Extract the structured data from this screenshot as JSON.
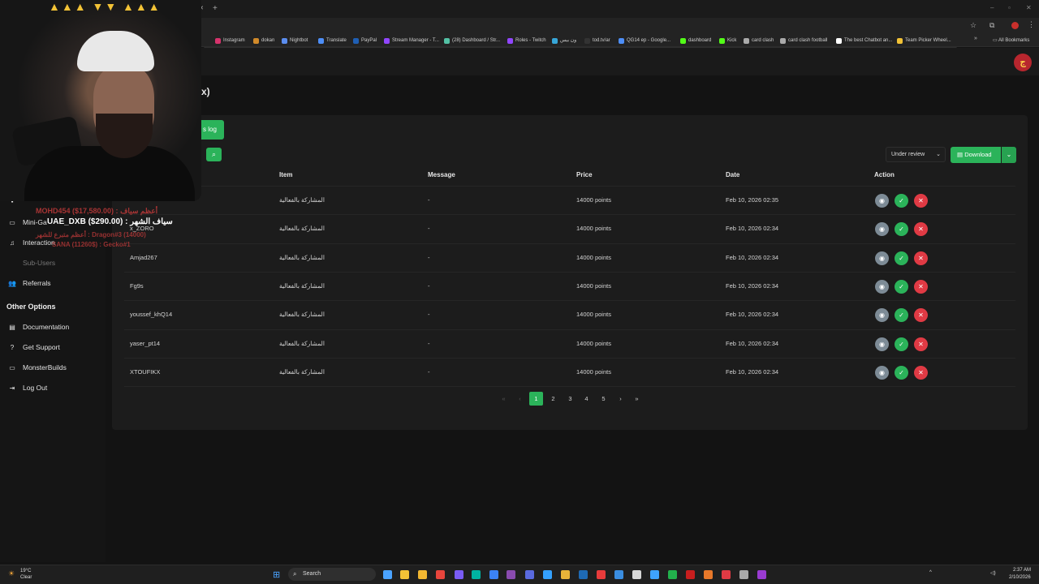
{
  "bookmarks": [
    {
      "label": "Instagram",
      "color": "#d6336c"
    },
    {
      "label": "dokan",
      "color": "#d18a2a"
    },
    {
      "label": "Nightbot",
      "color": "#5b8def"
    },
    {
      "label": "Translate",
      "color": "#4d8ef7"
    },
    {
      "label": "PayPal",
      "color": "#1f5fb4"
    },
    {
      "label": "Stream Manager - T...",
      "color": "#9146ff"
    },
    {
      "label": "(28) Dashboard / Str...",
      "color": "#53c1a5"
    },
    {
      "label": "Roles - Twitch",
      "color": "#9146ff"
    },
    {
      "label": "ون بيس",
      "color": "#37a6d8"
    },
    {
      "label": "tod.tv/ar",
      "color": "#333333"
    },
    {
      "label": "QG14 ep - Google...",
      "color": "#4d8ef7"
    },
    {
      "label": "dashboard",
      "color": "#53fc18"
    },
    {
      "label": "Kick",
      "color": "#53fc18"
    },
    {
      "label": "card clash",
      "color": "#aaaaaa"
    },
    {
      "label": "card clash football",
      "color": "#aaaaaa"
    },
    {
      "label": "The best Chatbot an...",
      "color": "#ffffff"
    },
    {
      "label": "Team Picker Wheel...",
      "color": "#f2c236"
    }
  ],
  "bookmarks_bar": {
    "all_bookmarks": "All Bookmarks"
  },
  "page": {
    "title_fragment": "x)"
  },
  "tabs": {
    "log_label": "s log"
  },
  "sidebar": {
    "items": [
      {
        "label": "Mini-Ga",
        "icon": "gamepad-icon",
        "glyph": "▭"
      },
      {
        "label": "Interaction",
        "icon": "music-icon",
        "glyph": "♫"
      },
      {
        "label": "Sub-Users",
        "icon": "users-icon",
        "glyph": "",
        "dim": true
      },
      {
        "label": "Referrals",
        "icon": "users-icon",
        "glyph": "👥"
      }
    ],
    "other_options_heading": "Other Options",
    "other_items": [
      {
        "label": "Documentation",
        "icon": "book-icon",
        "glyph": "▤"
      },
      {
        "label": "Get Support",
        "icon": "help-icon",
        "glyph": "?"
      },
      {
        "label": "MonsterBuilds",
        "icon": "monitor-icon",
        "glyph": "▭"
      },
      {
        "label": "Log Out",
        "icon": "logout-icon",
        "glyph": "⇥"
      }
    ]
  },
  "toolbar": {
    "status_filter": "Under review",
    "download_label": "Download"
  },
  "table": {
    "headers": [
      "Item",
      "Message",
      "Price",
      "Date",
      "Action"
    ],
    "rows": [
      {
        "user": "",
        "item": "المشاركة بالفعالية",
        "message": "-",
        "price": "14000 points",
        "date": "Feb 10, 2026 02:35"
      },
      {
        "user": "x_ZORO",
        "item": "المشاركة بالفعالية",
        "message": "-",
        "price": "14000 points",
        "date": "Feb 10, 2026 02:34"
      },
      {
        "user": "Amjad267",
        "item": "المشاركة بالفعالية",
        "message": "-",
        "price": "14000 points",
        "date": "Feb 10, 2026 02:34"
      },
      {
        "user": "Fg9s",
        "item": "المشاركة بالفعالية",
        "message": "-",
        "price": "14000 points",
        "date": "Feb 10, 2026 02:34"
      },
      {
        "user": "youssef_khQ14",
        "item": "المشاركة بالفعالية",
        "message": "-",
        "price": "14000 points",
        "date": "Feb 10, 2026 02:34"
      },
      {
        "user": "yaser_pt14",
        "item": "المشاركة بالفعالية",
        "message": "-",
        "price": "14000 points",
        "date": "Feb 10, 2026 02:34"
      },
      {
        "user": "XTOUFIKX",
        "item": "المشاركة بالفعالية",
        "message": "-",
        "price": "14000 points",
        "date": "Feb 10, 2026 02:34"
      }
    ]
  },
  "pagination": {
    "first": "«",
    "prev": "‹",
    "pages": [
      "1",
      "2",
      "3",
      "4",
      "5"
    ],
    "current": "1",
    "next": "›",
    "last": "»"
  },
  "overlay": {
    "top_donor_1": "MOHD454 ($17,580.00) : أعظم سياف",
    "top_month": "UAE_DXB ($290.00) : سياف الشهر",
    "line_3": "أعظم متبرع للشهر : Dragon#3 (14000)",
    "line_4": "SANA (11260$) : Gecko#1"
  },
  "taskbar": {
    "weather_temp": "19°C",
    "weather_desc": "Clear",
    "search": "Search",
    "time": "2:37 AM",
    "date": "2/10/2026"
  },
  "colors": {
    "accent": "#2bb35a",
    "reject": "#e03a44",
    "view": "#7d8b96"
  }
}
